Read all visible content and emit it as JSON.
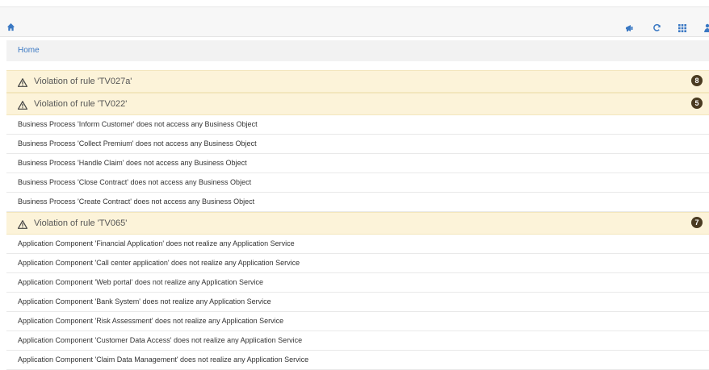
{
  "toolbar": {
    "home_icon": "home-icon",
    "icons": [
      "megaphone-icon",
      "refresh-icon",
      "grid-icon",
      "user-icon"
    ]
  },
  "breadcrumb": {
    "home": "Home"
  },
  "groups": [
    {
      "title": "Violation of rule 'TV027a'",
      "count": "8",
      "items": []
    },
    {
      "title": "Violation of rule 'TV022'",
      "count": "5",
      "items": [
        "Business Process 'Inform Customer' does not access any Business Object",
        "Business Process 'Collect Premium' does not access any Business Object",
        "Business Process 'Handle Claim' does not access any Business Object",
        "Business Process 'Close Contract' does not access any Business Object",
        "Business Process 'Create Contract' does not access any Business Object"
      ]
    },
    {
      "title": "Violation of rule 'TV065'",
      "count": "7",
      "items": [
        "Application Component 'Financial Application' does not realize any Application Service",
        "Application Component 'Call center application' does not realize any Application Service",
        "Application Component 'Web portal' does not realize any Application Service",
        "Application Component 'Bank System' does not realize any Application Service",
        "Application Component 'Risk Assessment' does not realize any Application Service",
        "Application Component 'Customer Data Access' does not realize any Application Service",
        "Application Component 'Claim Data Management' does not realize any Application Service"
      ]
    }
  ],
  "colors": {
    "accent": "#3a78c3",
    "header_bg": "#fcf3d9",
    "badge": "#4a3b21"
  }
}
